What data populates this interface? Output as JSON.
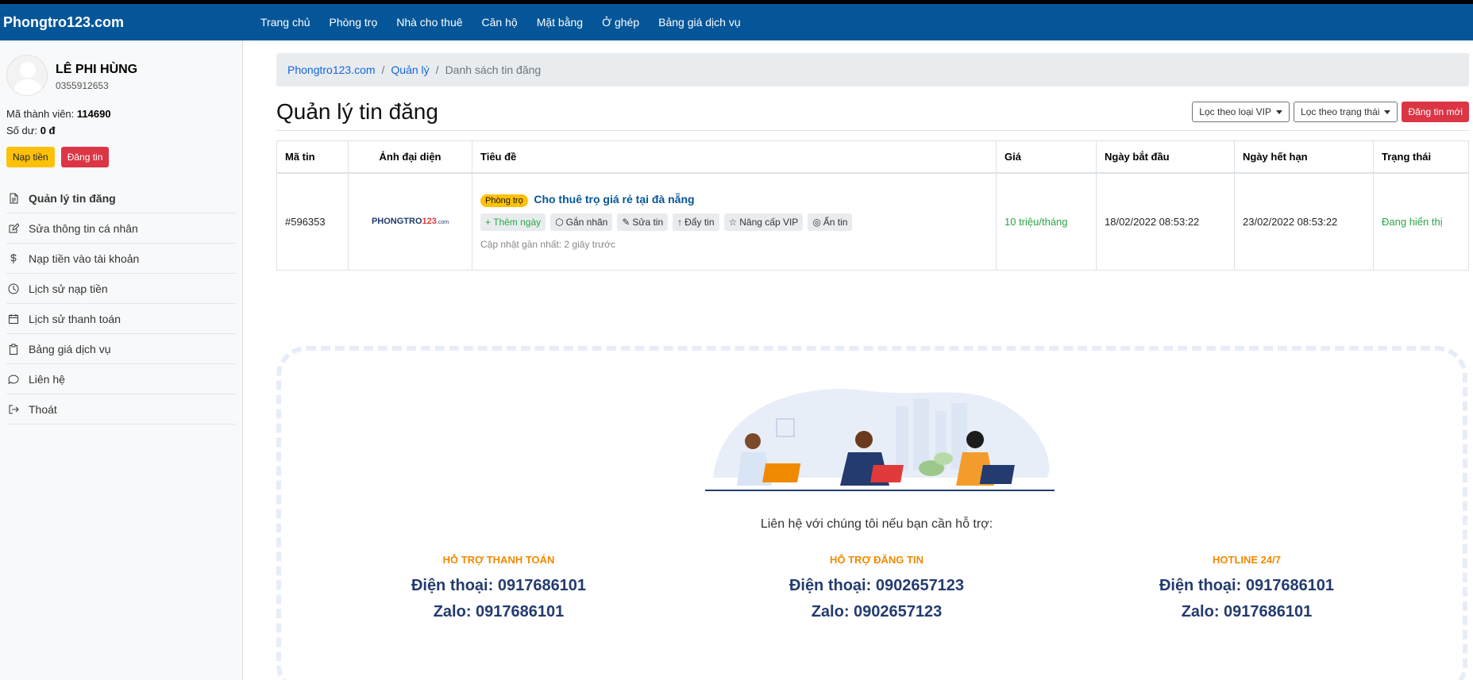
{
  "navbar": {
    "brand": "Phongtro123.com",
    "items": [
      "Trang chủ",
      "Phòng trọ",
      "Nhà cho thuê",
      "Căn hộ",
      "Mặt bằng",
      "Ở ghép",
      "Bảng giá dịch vụ"
    ]
  },
  "user": {
    "name": "LÊ PHI HÙNG",
    "phone": "0355912653",
    "member_label": "Mã thành viên:",
    "member_id": "114690",
    "balance_label": "Số dư:",
    "balance": "0 đ",
    "topup_button": "Nạp tiền",
    "post_button": "Đăng tin"
  },
  "sidebar": {
    "items": [
      {
        "label": "Quản lý tin đăng",
        "icon": "document-icon"
      },
      {
        "label": "Sửa thông tin cá nhân",
        "icon": "edit-icon"
      },
      {
        "label": "Nạp tiền vào tài khoản",
        "icon": "dollar-icon"
      },
      {
        "label": "Lịch sử nạp tiền",
        "icon": "clock-icon"
      },
      {
        "label": "Lịch sử thanh toán",
        "icon": "calendar-icon"
      },
      {
        "label": "Bảng giá dịch vụ",
        "icon": "clipboard-icon"
      },
      {
        "label": "Liên hệ",
        "icon": "chat-icon"
      },
      {
        "label": "Thoát",
        "icon": "logout-icon"
      }
    ]
  },
  "breadcrumb": {
    "home": "Phongtro123.com",
    "manage": "Quản lý",
    "current": "Danh sách tin đăng"
  },
  "page": {
    "title": "Quản lý tin đăng",
    "filter_vip": "Lọc theo loại VIP",
    "filter_status": "Lọc theo trạng thái",
    "new_post": "Đăng tin mới"
  },
  "table": {
    "headers": [
      "Mã tin",
      "Ảnh đại diện",
      "Tiêu đề",
      "Giá",
      "Ngày bắt đầu",
      "Ngày hết hạn",
      "Trạng thái"
    ],
    "rows": [
      {
        "id": "#596353",
        "thumb_logo_main": "PHONGTRO",
        "thumb_logo_num": "123",
        "thumb_logo_domain": ".com",
        "category": "Phòng trọ",
        "title": "Cho thuê trọ giá rẻ tại đà nẵng",
        "actions": [
          "+ Thêm ngày",
          "Gắn nhãn",
          "Sửa tin",
          "Đẩy tin",
          "Nâng cấp VIP",
          "Ẩn tin"
        ],
        "updated": "Cập nhật gần nhất: 2 giây trước",
        "price": "10 triệu/tháng",
        "start": "18/02/2022 08:53:22",
        "end": "23/02/2022 08:53:22",
        "status": "Đang hiển thị"
      }
    ]
  },
  "support": {
    "text": "Liên hệ với chúng tôi nếu bạn cần hỗ trợ:",
    "columns": [
      {
        "heading": "HỖ TRỢ THANH TOÁN",
        "phone": "Điện thoại: 0917686101",
        "zalo": "Zalo: 0917686101"
      },
      {
        "heading": "HỖ TRỢ ĐĂNG TIN",
        "phone": "Điện thoại: 0902657123",
        "zalo": "Zalo: 0902657123"
      },
      {
        "heading": "HOTLINE 24/7",
        "phone": "Điện thoại: 0917686101",
        "zalo": "Zalo: 0917686101"
      }
    ]
  },
  "colors": {
    "navbar": "#055699",
    "accent_green": "#28a745",
    "danger": "#dc3545",
    "warning": "#ffc107",
    "support_heading": "#f08a00",
    "support_text": "#233b6e"
  }
}
